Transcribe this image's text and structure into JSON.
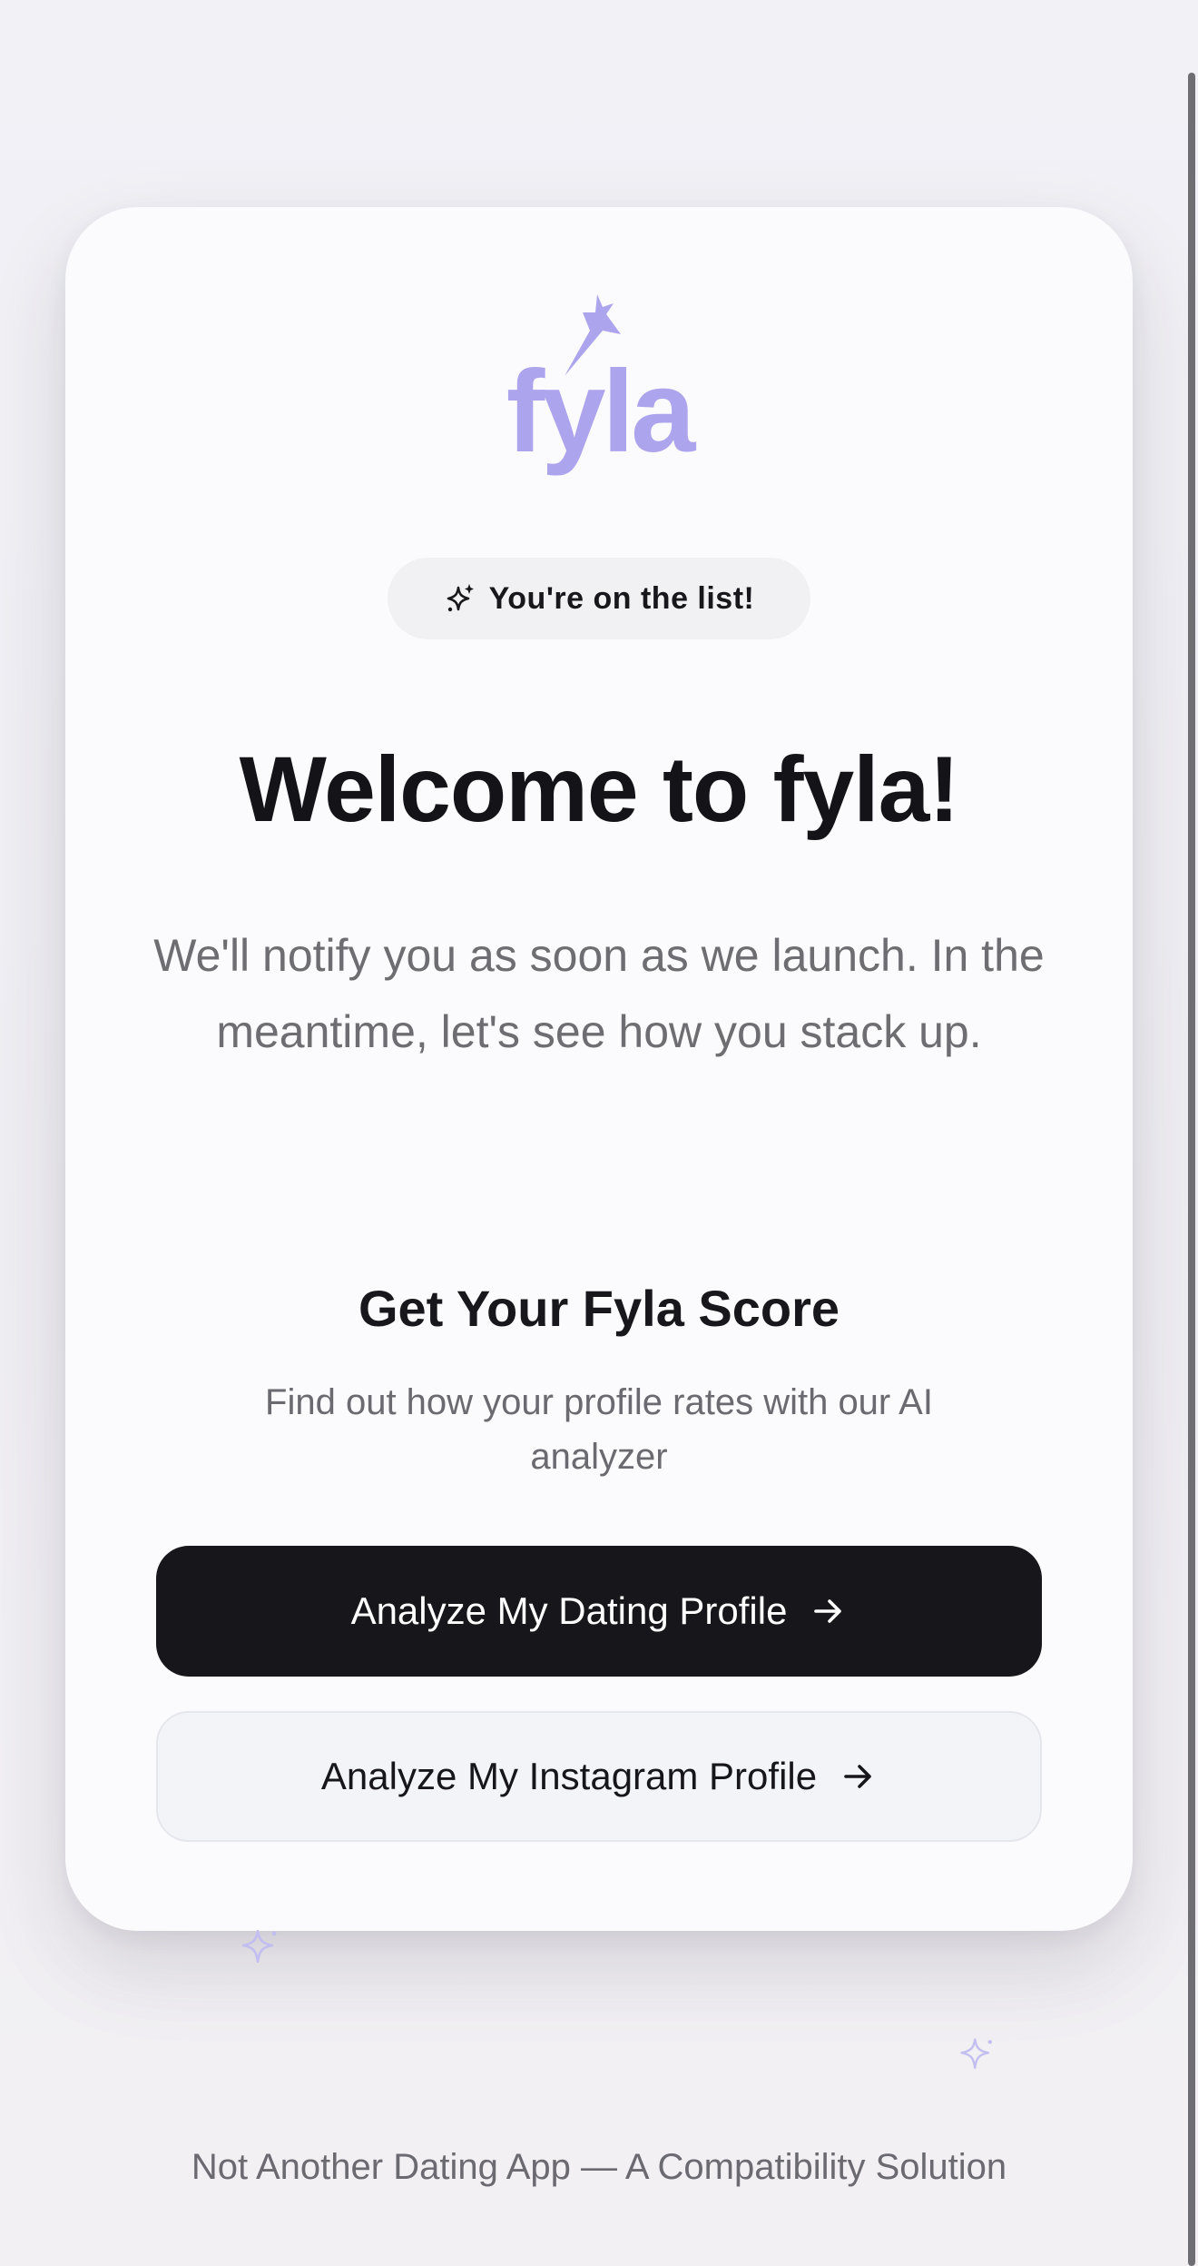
{
  "brand": {
    "name": "fyla",
    "logo_color": "#ada4ee"
  },
  "badge": {
    "icon": "sparkles-icon",
    "text": "You're on the list!"
  },
  "hero": {
    "title": "Welcome to fyla!",
    "subtitle": "We'll notify you as soon as we launch. In the meantime, let's see how you stack up."
  },
  "score": {
    "title": "Get Your Fyla Score",
    "description": "Find out how your profile rates with our AI analyzer"
  },
  "actions": {
    "dating_label": "Analyze My Dating Profile",
    "instagram_label": "Analyze My Instagram Profile",
    "icon": "arrow-right-icon"
  },
  "footer": {
    "tagline": "Not Another Dating App — A Compatibility Solution"
  },
  "colors": {
    "primary_button": "#17171b",
    "secondary_button": "#f3f4f8",
    "accent": "#ada4ee"
  }
}
